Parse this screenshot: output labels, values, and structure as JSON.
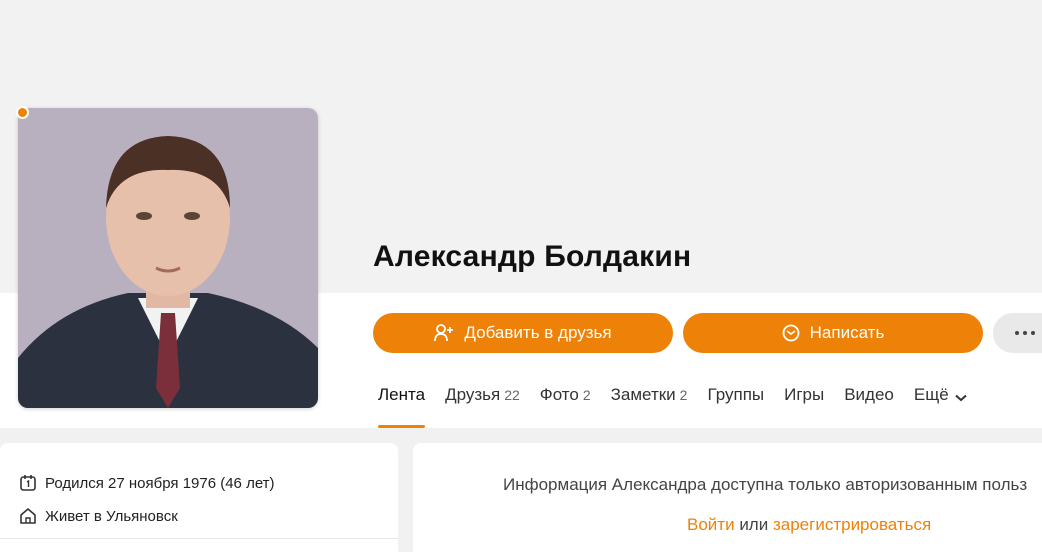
{
  "profile": {
    "name": "Александр Болдакин",
    "birth": "Родился 27 ноября 1976 (46 лет)",
    "lives": "Живет в Ульяновск"
  },
  "actions": {
    "add_friend": "Добавить в друзья",
    "write": "Написать"
  },
  "tabs": [
    {
      "label": "Лента",
      "count": ""
    },
    {
      "label": "Друзья",
      "count": "22"
    },
    {
      "label": "Фото",
      "count": "2"
    },
    {
      "label": "Заметки",
      "count": "2"
    },
    {
      "label": "Группы",
      "count": ""
    },
    {
      "label": "Игры",
      "count": ""
    },
    {
      "label": "Видео",
      "count": ""
    },
    {
      "label": "Ещё",
      "count": ""
    }
  ],
  "notice": {
    "text": "Информация Александра доступна только авторизованным польз",
    "login": "Войти",
    "or": "или",
    "register": "зарегистрироваться"
  },
  "colors": {
    "accent": "#ee8208",
    "background": "#f1f1f1"
  },
  "icons": [
    "add-friend-icon",
    "mail-icon",
    "more-dots-icon",
    "calendar-icon",
    "home-icon",
    "chevron-down-icon"
  ]
}
